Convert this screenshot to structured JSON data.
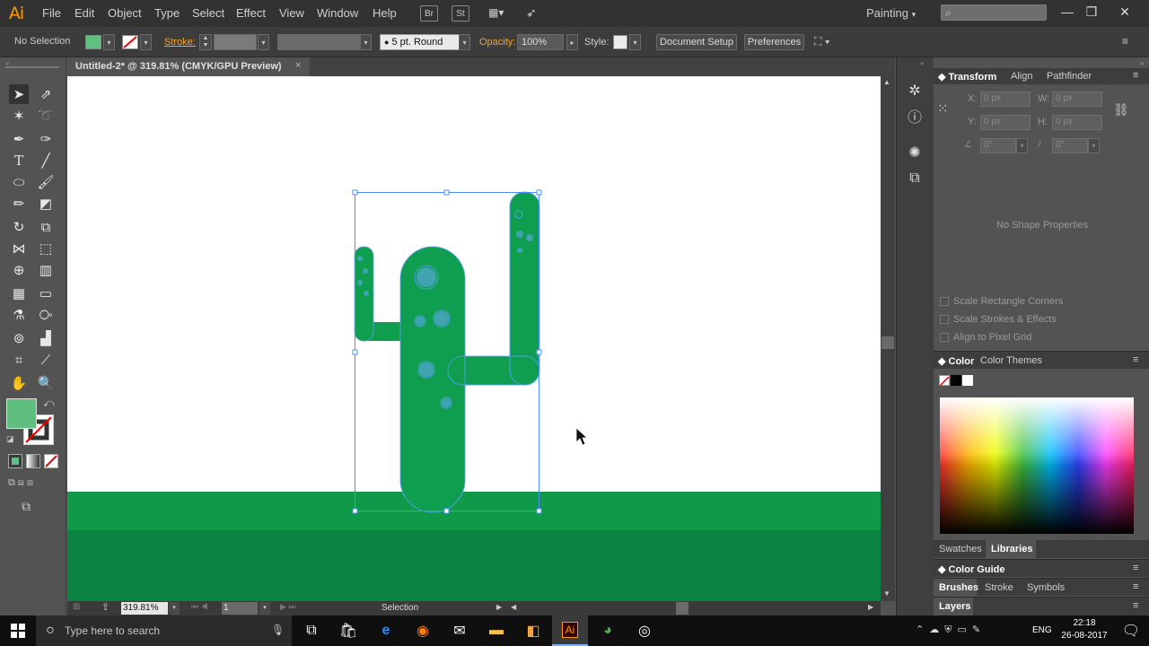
{
  "app": {
    "logo": "Ai",
    "menu": [
      "File",
      "Edit",
      "Object",
      "Type",
      "Select",
      "Effect",
      "View",
      "Window",
      "Help"
    ],
    "bridge_badge": "Br",
    "stock_badge": "St",
    "workspace": "Painting",
    "window_controls": [
      "minimize-icon",
      "restore-icon",
      "close-icon"
    ]
  },
  "control_bar": {
    "selection_status": "No Selection",
    "fill_color": "#5fbf7f",
    "stroke_label": "Stroke:",
    "brush": "5 pt. Round",
    "opacity_label": "Opacity:",
    "opacity_value": "100%",
    "style_label": "Style:",
    "document_setup": "Document Setup",
    "preferences": "Preferences"
  },
  "document": {
    "tab_title": "Untitled-2* @ 319.81% (CMYK/GPU Preview)",
    "close_glyph": "×",
    "zoom": "319.81%",
    "artboard_number": "1",
    "status_tool": "Selection",
    "colors": {
      "cactus": "#0f9e50",
      "ground_top": "#0f9a4a",
      "ground_bottom": "#0a8242",
      "selection": "#4a90ff"
    }
  },
  "panels": {
    "transform_tabs": [
      "Transform",
      "Align",
      "Pathfinder"
    ],
    "x_label": "X:",
    "x_value": "0 px",
    "y_label": "Y:",
    "y_value": "0 px",
    "w_label": "W:",
    "w_value": "0 px",
    "h_label": "H:",
    "h_value": "0 px",
    "angle_value": "0°",
    "shear_value": "0°",
    "no_shape": "No Shape Properties",
    "options": [
      "Scale Rectangle Corners",
      "Scale Strokes & Effects",
      "Align to Pixel Grid"
    ],
    "color_tabs": [
      "Color",
      "Color Themes"
    ],
    "lib_tabs": [
      "Swatches",
      "Libraries"
    ],
    "color_guide": "Color Guide",
    "brush_tabs": [
      "Brushes",
      "Stroke",
      "Symbols"
    ],
    "layers": "Layers"
  },
  "taskbar": {
    "search_placeholder": "Type here to search",
    "lang": "ENG",
    "time": "22:18",
    "date": "26-08-2017"
  }
}
